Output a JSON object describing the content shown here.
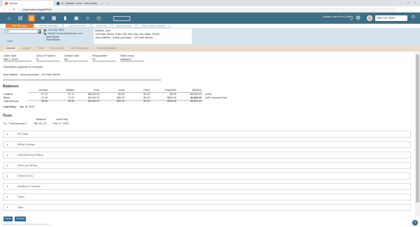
{
  "browser": {
    "tabs": [
      {
        "title": "Soluno",
        "active": true,
        "color": "#e87f2b"
      },
      {
        "title": "11 - Bartlett, John - John Bartle",
        "active": false,
        "color": "#2a5d78"
      }
    ],
    "url": "cloud.soluno.legal/#/File/",
    "new_tab": "+",
    "tab_close": "×",
    "win_min": "–",
    "win_max": "□",
    "win_close": "×",
    "nav_back": "←",
    "nav_fwd": "→",
    "nav_reload": "↻"
  },
  "appbar": {
    "icons": [
      "home-icon",
      "documents-icon",
      "file-icon",
      "add-icon",
      "bank-icon",
      "stats-icon",
      "calendar-icon",
      "people-icon",
      "clock-icon"
    ],
    "glyphs": [
      "⌂",
      "▤",
      "▥",
      "⊕",
      "▦",
      "▮",
      "▣",
      "☺",
      "◷"
    ],
    "firm_name": "Soluno Law Firm (Cash)",
    "firm_user": "A7",
    "date": "Mar 16, 2020",
    "settings_glyph": "⚙",
    "power_glyph": "⏻"
  },
  "subtabs": [
    {
      "label": "File Manager",
      "active": true
    },
    {
      "label": "Contact Manager",
      "active": false
    },
    {
      "label": "Conflict Search",
      "active": false
    },
    {
      "label": "New File",
      "active": false
    },
    {
      "label": "New Contact",
      "active": false
    },
    {
      "label": "New Group Contact",
      "active": false
    }
  ],
  "header": {
    "matter_select": "11",
    "arrow_glyph": "▶",
    "phone": "123-456-7890",
    "email": "info@Cloudsolufsoftware.com",
    "contact_line1": "Adit Tylock",
    "contact_line2": "Real Estate",
    "client_name": "Bartlett, John",
    "address": "123 Main Street, Suite 300, Any City, Any State, 10030",
    "file_desc": "John Bartlett - house purchase - 123 Main Street",
    "minor_label": "Client"
  },
  "section_tabs": [
    {
      "label": "General",
      "active": true
    },
    {
      "label": "Ledger",
      "active": false
    },
    {
      "label": "Other",
      "active": false
    },
    {
      "label": "Documents",
      "active": false
    },
    {
      "label": "NetDocuments",
      "active": false
    },
    {
      "label": "Opening Balance",
      "active": false
    }
  ],
  "general": {
    "open_date_label": "Open Date",
    "open_date": "Mar 1, 2019",
    "area_label": "Area of Practice",
    "area": "re",
    "default_task_label": "Default Task",
    "default_task": "bw",
    "responsible_label": "Responsible",
    "responsible": "A7",
    "rate_group_label": "Rate Group",
    "rate_group": "standard",
    "desc_label": "Description (appears on invoices)",
    "desc": "John Bartlett - house purchase - 123 Main Street"
  },
  "balances": {
    "title": "Balances",
    "columns": [
      "Worked",
      "Billable",
      "Fees",
      "Costs",
      "Other",
      "Payments",
      "Balance"
    ],
    "rows": [
      {
        "label": "Unbilled",
        "values": [
          "27.12",
          "27.12",
          "$6,000.00",
          "$0.00",
          "$0.00",
          "$0.00",
          "-$6,000.00"
        ],
        "note": "(WIP)"
      },
      {
        "label": "Billed",
        "values": [
          "11.24",
          "11.24",
          "$3,254.00",
          "$50.00",
          "$0.00",
          "$500.00",
          "$2,834.00"
        ],
        "note": "(A/R / Amount Due)"
      },
      {
        "label": "Total Network",
        "values": [
          "38.36",
          "38.36",
          "$9,254.00",
          "$50.00",
          "$0.00",
          "$500.00",
          "$8,834.00"
        ],
        "note": ""
      }
    ],
    "last_entry_label": "Last Entry:",
    "last_entry": "Mar 16, 2020"
  },
  "trust": {
    "title": "Trust",
    "col_balance": "Balance",
    "col_last_entry": "Last Entry",
    "row_label": "11 - Trust Account 1",
    "row_balance": "$6,141.75",
    "row_last": "Feb 27, 2020"
  },
  "accordion": [
    "File Staff",
    "Billing Settings",
    "Split/Advanced Billing",
    "Electronic Billing",
    "Referred Info",
    "Additional Contacts",
    "Notes",
    "Tags"
  ],
  "accordion_glyph": "▸",
  "footer": {
    "save_label": "Save",
    "cancel_label": "Cancel",
    "copyright": "Soluno | Version 1.0 | © 2020 Soluno Software Inc.",
    "chat_glyph": "✎"
  }
}
